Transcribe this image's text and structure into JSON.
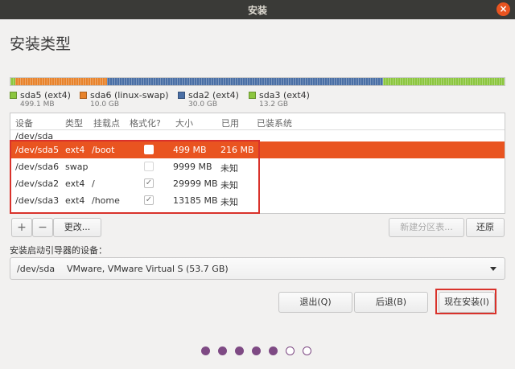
{
  "window": {
    "title": "安装",
    "close_symbol": "×"
  },
  "page_title": "安装类型",
  "partition_bar": [
    {
      "name": "sda5 (ext4)",
      "size": "499.1 MB",
      "color": "#8cc63f",
      "fraction": 0.0093
    },
    {
      "name": "sda6 (linux-swap)",
      "size": "10.0 GB",
      "color": "#e8832c",
      "fraction": 0.1862
    },
    {
      "name": "sda2 (ext4)",
      "size": "30.0 GB",
      "color": "#4a6fa5",
      "fraction": 0.5587
    },
    {
      "name": "sda3 (ext4)",
      "size": "13.2 GB",
      "color": "#8cc63f",
      "fraction": 0.2458
    }
  ],
  "table": {
    "headers": [
      "设备",
      "类型",
      "挂载点",
      "格式化?",
      "大小",
      "已用",
      "已装系统"
    ],
    "device": "/dev/sda",
    "rows": [
      {
        "device": "/dev/sda5",
        "type": "ext4",
        "mount": "/boot",
        "format": false,
        "size": "499 MB",
        "used": "216 MB",
        "selected": true
      },
      {
        "device": "/dev/sda6",
        "type": "swap",
        "mount": "",
        "format": false,
        "size": "9999 MB",
        "used": "未知",
        "selected": false
      },
      {
        "device": "/dev/sda2",
        "type": "ext4",
        "mount": "/",
        "format": true,
        "size": "29999 MB",
        "used": "未知",
        "selected": false
      },
      {
        "device": "/dev/sda3",
        "type": "ext4",
        "mount": "/home",
        "format": true,
        "size": "13185 MB",
        "used": "未知",
        "selected": false
      }
    ]
  },
  "table_buttons": {
    "add": "+",
    "remove": "−",
    "change": "更改...",
    "new_table": "新建分区表...",
    "revert": "还原"
  },
  "boot_loader": {
    "label": "安装启动引导器的设备：",
    "device": "/dev/sda",
    "description": "VMware, VMware Virtual S (53.7 GB)"
  },
  "buttons": {
    "quit": "退出(Q)",
    "back": "后退(B)",
    "install_now": "现在安装(I)"
  },
  "progress": {
    "total_steps": 7,
    "completed_steps": 5
  },
  "colors": {
    "accent": "#e95420",
    "highlight_box": "#d9322b",
    "progress_dot": "#7e4a84"
  }
}
